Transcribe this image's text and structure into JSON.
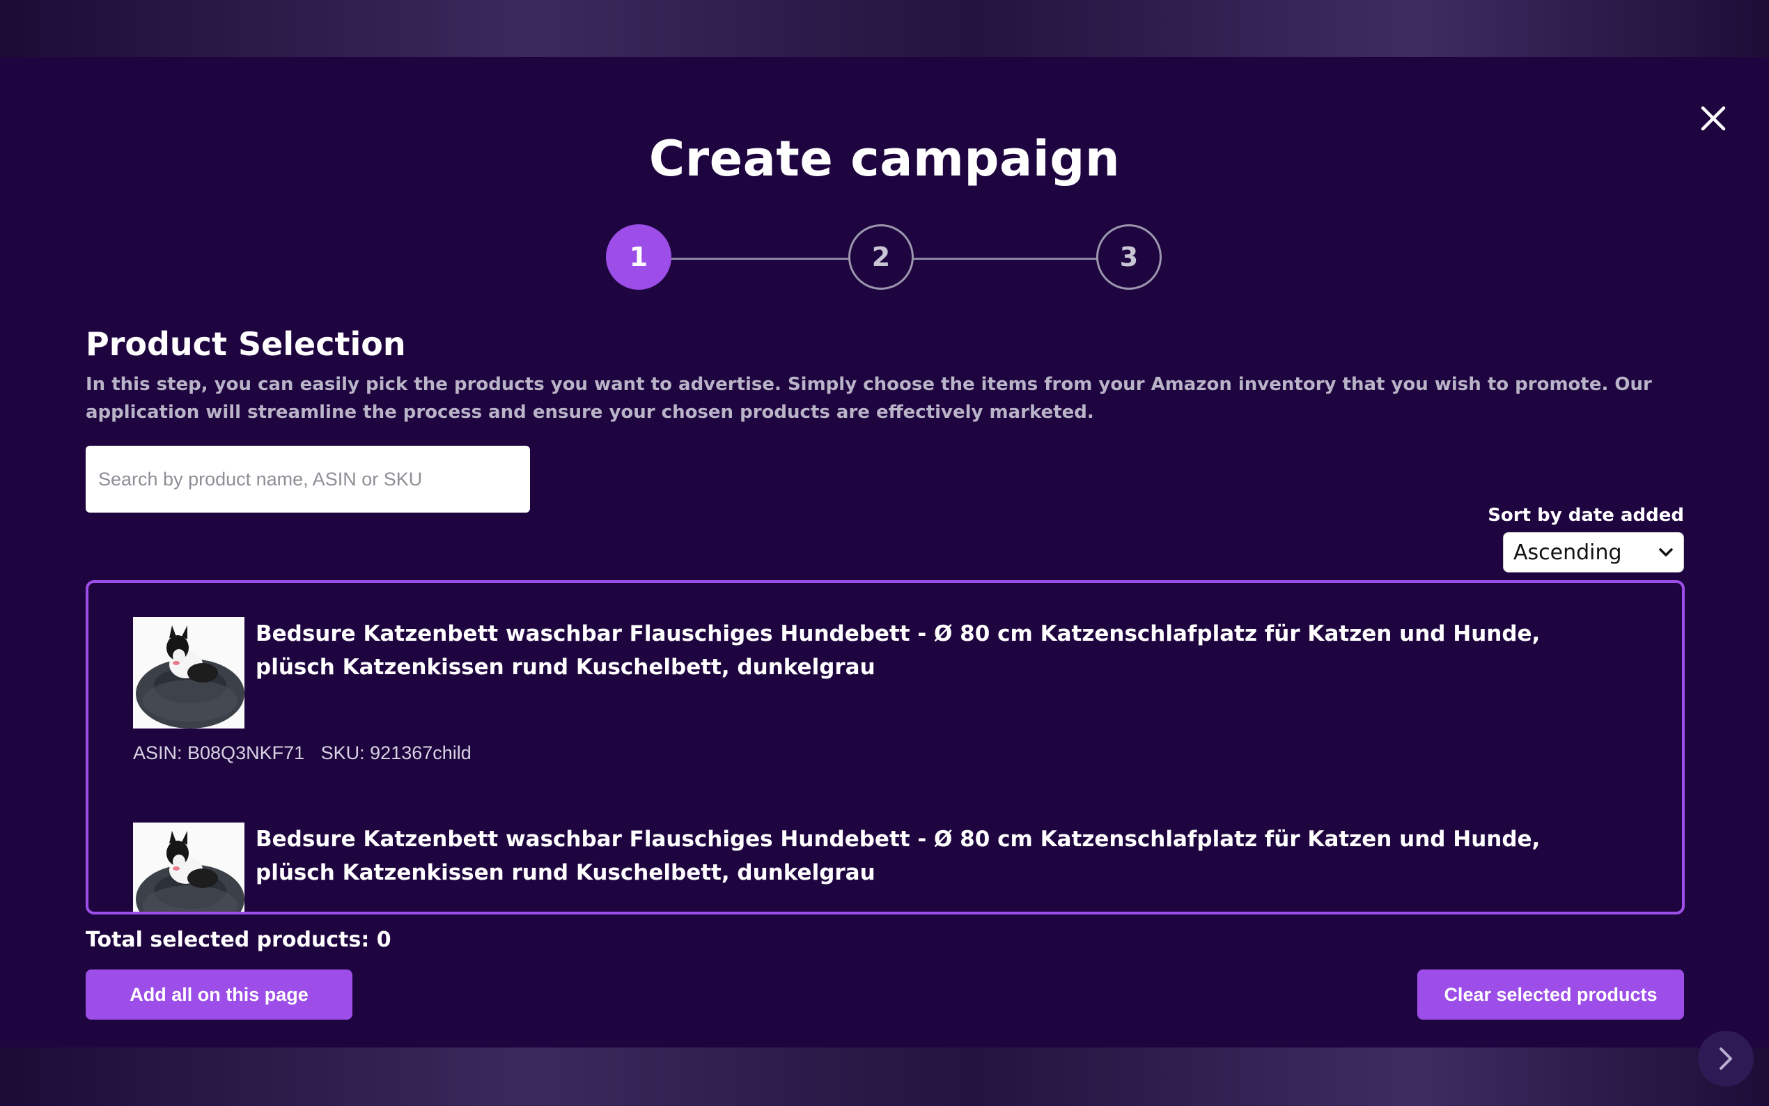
{
  "modal": {
    "title": "Create campaign",
    "close_icon": "close-icon",
    "steps": [
      "1",
      "2",
      "3"
    ],
    "active_step": 1
  },
  "section": {
    "title": "Product Selection",
    "description": "In this step, you can easily pick the products you want to advertise. Simply choose the items from your Amazon inventory that you wish to promote. Our application will streamline the process and ensure your chosen products are effectively marketed."
  },
  "search": {
    "placeholder": "Search by product name, ASIN or SKU",
    "value": ""
  },
  "sort": {
    "label": "Sort by date added",
    "selected": "Ascending"
  },
  "products": [
    {
      "title": "Bedsure Katzenbett waschbar Flauschiges Hundebett - Ø 80 cm Katzenschlafplatz für Katzen und Hunde, plüsch Katzenkissen rund Kuschelbett, dunkelgrau",
      "asin": "ASIN: B08Q3NKF71",
      "sku": "SKU: 921367child"
    },
    {
      "title": "Bedsure Katzenbett waschbar Flauschiges Hundebett - Ø 80 cm Katzenschlafplatz für Katzen und Hunde, plüsch Katzenkissen rund Kuschelbett, dunkelgrau"
    }
  ],
  "footer": {
    "total_label": "Total selected products: 0",
    "add_all_label": "Add all on this page",
    "clear_label": "Clear selected products",
    "next_icon": "chevron-right-icon"
  },
  "colors": {
    "accent": "#9d4ee8",
    "modal_bg": "#1f0540"
  }
}
